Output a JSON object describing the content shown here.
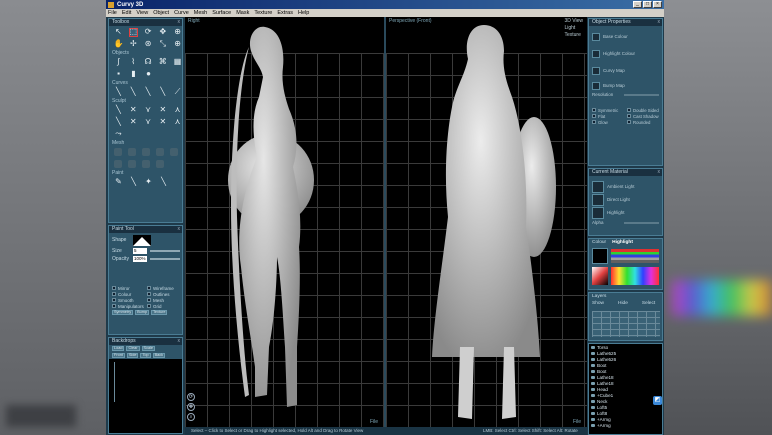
{
  "window": {
    "title": "Curvy 3D",
    "min": "_",
    "max": "□",
    "close": "×"
  },
  "menu": [
    "File",
    "Edit",
    "View",
    "Object",
    "Curve",
    "Mesh",
    "Surface",
    "Mask",
    "Texture",
    "Extras",
    "Help"
  ],
  "left": {
    "toolbox_title": "Toolbox",
    "close_glyph": "x",
    "objects_label": "Objects",
    "curves_label": "Curves",
    "sculpt_label": "Sculpt",
    "mesh_label": "Mesh",
    "paint_label": "Paint",
    "paint_tool": {
      "title": "Paint Tool",
      "shape_label": "Shape",
      "size_label": "Size",
      "size_value": "5",
      "opacity_label": "Opacity",
      "opacity_value": "100%",
      "checks": [
        [
          "Mirror",
          "Wireframe"
        ],
        [
          "Colour",
          "Outlines"
        ],
        [
          "Smooth",
          "Mesh"
        ],
        [
          "Manipulators",
          "Grid"
        ]
      ],
      "buttons": [
        "Symmetry",
        "Bump",
        "Texture"
      ]
    },
    "backdrops": {
      "title": "Backdrops",
      "buttons_row1": [
        "Load",
        "Clear",
        "Scale"
      ],
      "buttons_row2": [
        "Front",
        "Side",
        "Top",
        "Back"
      ]
    }
  },
  "viewport_left": {
    "name": "Right",
    "file": "File"
  },
  "viewport_right": {
    "name": "Perspective (Front)",
    "options": [
      "3D View",
      "Light",
      "Texture"
    ],
    "file": "File"
  },
  "right": {
    "props_title": "Object Properties",
    "close_glyph": "x",
    "props_rows": [
      "Base Colour",
      "Highlight Colour",
      "Curvy Map",
      "Bump Map"
    ],
    "resolution_label": "Resolution",
    "props_checks": [
      [
        "Symmetric",
        "Double Sided"
      ],
      [
        "Flat",
        "Cast Shadow"
      ],
      [
        "Glow",
        "Rounded"
      ]
    ],
    "material_title": "Current Material",
    "material_rows": [
      "Ambient Light",
      "Direct Light",
      "Highlight"
    ],
    "alpha_label": "Alpha",
    "color_tabs": [
      "Colour",
      "Highlight"
    ],
    "layer_tabs": [
      "Layers",
      "Show",
      "Hide",
      "Select"
    ],
    "objects": [
      "Torso",
      "Lathe525",
      "Lathe526",
      "Boot",
      "Boot",
      "Lathe18",
      "Lathe18",
      "Head",
      "+Cube1",
      "Neck",
      "Loft5",
      "Loft8",
      "+Armg",
      "+Armg"
    ]
  },
  "status": {
    "text": "Select – Click to Select or Drag to Highlight selected, Hold Alt and Drag to Rotate View",
    "shortcuts": "LMB: Select   Ctrl: Select   Shift: Select   Alt: Rotate"
  },
  "colors": {
    "viewport_bg": "#000000",
    "panel_bg": "#2e5468",
    "mesh": "#c8c8c8",
    "title_blue": "#0a246a"
  }
}
